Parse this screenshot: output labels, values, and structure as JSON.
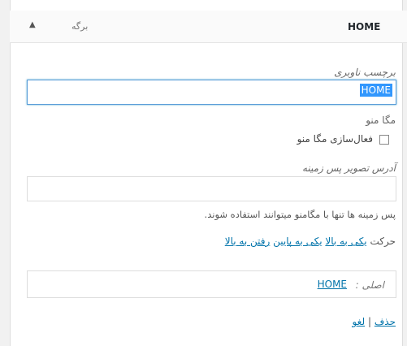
{
  "item": {
    "title": "HOME",
    "type_label": "برگه",
    "toggle_icon": "▲"
  },
  "nav_label": {
    "label": "برچسب ناوبری",
    "value": "HOME"
  },
  "mega_menu": {
    "heading": "مگا منو",
    "checkbox_label": "فعال‌سازی مگا منو",
    "checked": false
  },
  "background": {
    "label": "آدرس تصویر پس زمینه",
    "value": "",
    "note": "پس زمینه ها تنها با مگامنو میتوانند استفاده شوند."
  },
  "move": {
    "label": "حرکت",
    "links": [
      "یکی به بالا",
      "یکی به پایین",
      "رفتن به بالا"
    ]
  },
  "original": {
    "label": "اصلی :",
    "link": "HOME"
  },
  "actions": {
    "delete": "حذف",
    "separator": "|",
    "cancel": "لغو"
  }
}
